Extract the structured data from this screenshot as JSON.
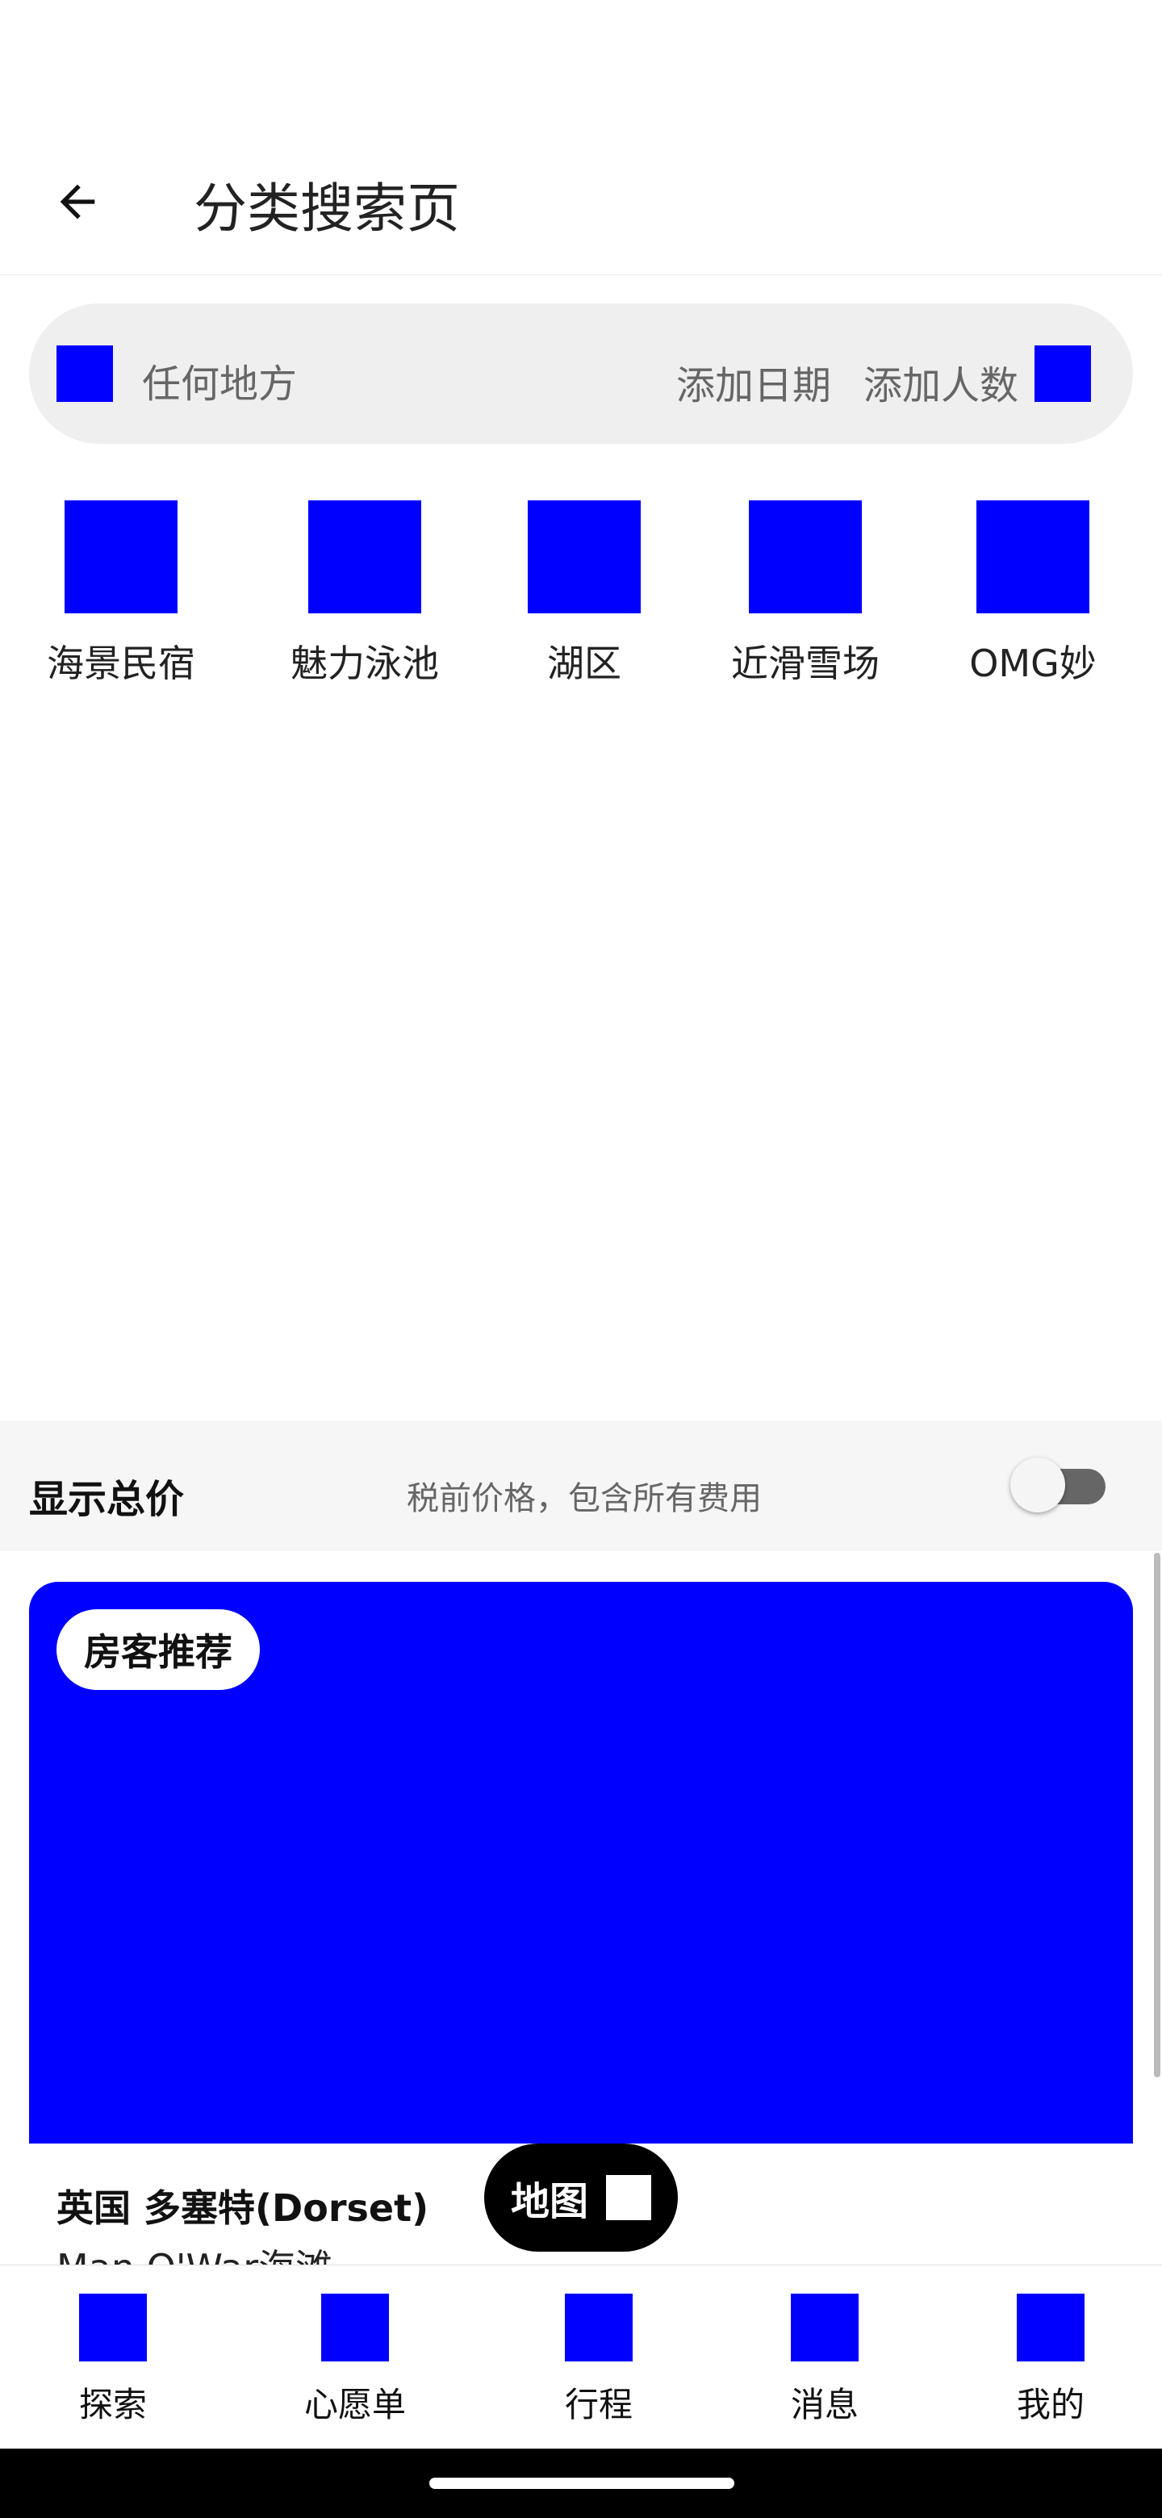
{
  "header": {
    "title": "分类搜索页"
  },
  "search": {
    "location": "任何地方",
    "date": "添加日期",
    "guests": "添加人数"
  },
  "categories": [
    {
      "label": "海景民宿"
    },
    {
      "label": "魅力泳池"
    },
    {
      "label": "湖区"
    },
    {
      "label": "近滑雪场"
    },
    {
      "label": "OMG妙"
    }
  ],
  "price_toggle": {
    "title": "显示总价",
    "subtitle": "税前价格，包含所有费用",
    "enabled": false
  },
  "listing": {
    "badge": "房客推荐",
    "title": "英国 多塞特(Dorset)",
    "subtitle": "Man O'War海滩"
  },
  "map_button": {
    "label": "地图"
  },
  "bottom_nav": [
    {
      "label": "探索"
    },
    {
      "label": "心愿单"
    },
    {
      "label": "行程"
    },
    {
      "label": "消息"
    },
    {
      "label": "我的"
    }
  ],
  "colors": {
    "placeholder_blue": "#0000ff",
    "search_bg": "#efefef",
    "price_bar_bg": "#f6f6f6"
  }
}
